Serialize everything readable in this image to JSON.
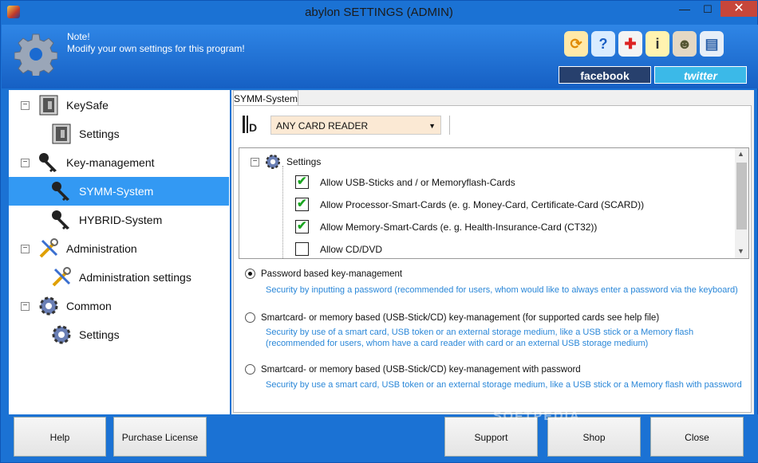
{
  "window": {
    "title": "abylon SETTINGS (ADMIN)",
    "minimize": "—",
    "maximize": "☐",
    "close": "✕"
  },
  "header": {
    "note_title": "Note!",
    "note_text": "Modify your own settings for this program!",
    "tool_icons": [
      "refresh-icon",
      "help-icon",
      "first-aid-icon",
      "info-icon",
      "user-icon",
      "id-card-icon"
    ],
    "facebook_label": "facebook",
    "twitter_label": "twitter"
  },
  "sidebar": {
    "items": [
      {
        "label": "KeySafe",
        "icon": "safe-icon"
      },
      {
        "label": "Settings",
        "icon": "safe-icon"
      },
      {
        "label": "Key-management",
        "icon": "key-icon"
      },
      {
        "label": "SYMM-System",
        "icon": "key-icon"
      },
      {
        "label": "HYBRID-System",
        "icon": "key-icon"
      },
      {
        "label": "Administration",
        "icon": "tools-icon"
      },
      {
        "label": "Administration settings",
        "icon": "tools-icon"
      },
      {
        "label": "Common",
        "icon": "gear-icon"
      },
      {
        "label": "Settings",
        "icon": "gear-icon"
      }
    ],
    "selected": "SYMM-System"
  },
  "content": {
    "tab_label": "SYMM-System",
    "reader_select": "ANY CARD READER",
    "settings_root": "Settings",
    "settings": [
      {
        "label": "Allow USB-Sticks and / or Memoryflash-Cards",
        "checked": true
      },
      {
        "label": "Allow Processor-Smart-Cards (e. g. Money-Card, Certificate-Card (SCARD))",
        "checked": true
      },
      {
        "label": "Allow Memory-Smart-Cards (e. g. Health-Insurance-Card (CT32))",
        "checked": true
      },
      {
        "label": "Allow CD/DVD",
        "checked": false
      }
    ],
    "options": [
      {
        "label": "Password based key-management",
        "selected": true,
        "desc": [
          "Security by inputting a password (recommended for users, whom would like to always enter a password via the keyboard)"
        ]
      },
      {
        "label": "Smartcard- or memory based (USB-Stick/CD) key-management (for supported cards see help file)",
        "selected": false,
        "desc": [
          "Security by use of a smart card, USB token or an external storage medium, like a USB stick or a Memory flash",
          "(recommended for users, whom have a card reader with card or an external USB storage medium)"
        ]
      },
      {
        "label": "Smartcard- or memory based (USB-Stick/CD) key-management with password",
        "selected": false,
        "desc": [
          "Security by use a smart card, USB token or an external storage medium, like a USB stick or a Memory flash with password"
        ]
      }
    ]
  },
  "footer": {
    "help": "Help",
    "purchase": "Purchase License",
    "support": "Support",
    "shop": "Shop",
    "close": "Close"
  },
  "watermark": "SOFTPEDIA",
  "colors": {
    "window_blue": "#1b72d4",
    "selection": "#3399f3",
    "desc_text": "#2a87d8",
    "check_green": "#1aa520"
  }
}
